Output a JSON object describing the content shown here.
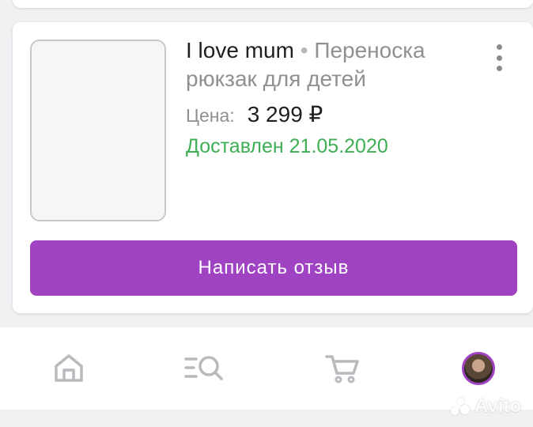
{
  "order": {
    "brand": "I love mum",
    "separator": "•",
    "product_name": "Переноска рюкзак для детей",
    "price_label": "Цена:",
    "price_value": "3 299 ₽",
    "status": "Доставлен 21.05.2020",
    "review_button_label": "Написать отзыв"
  },
  "nav": {
    "items": [
      {
        "icon": "home-icon"
      },
      {
        "icon": "catalog-search-icon"
      },
      {
        "icon": "cart-icon"
      },
      {
        "icon": "profile-avatar"
      }
    ]
  },
  "watermark": {
    "text": "Avito"
  },
  "colors": {
    "accent": "#a043c3",
    "status_green": "#3fae55",
    "text_primary": "#1f1f22",
    "text_secondary": "#909093",
    "nav_icon": "#b9b9be"
  }
}
